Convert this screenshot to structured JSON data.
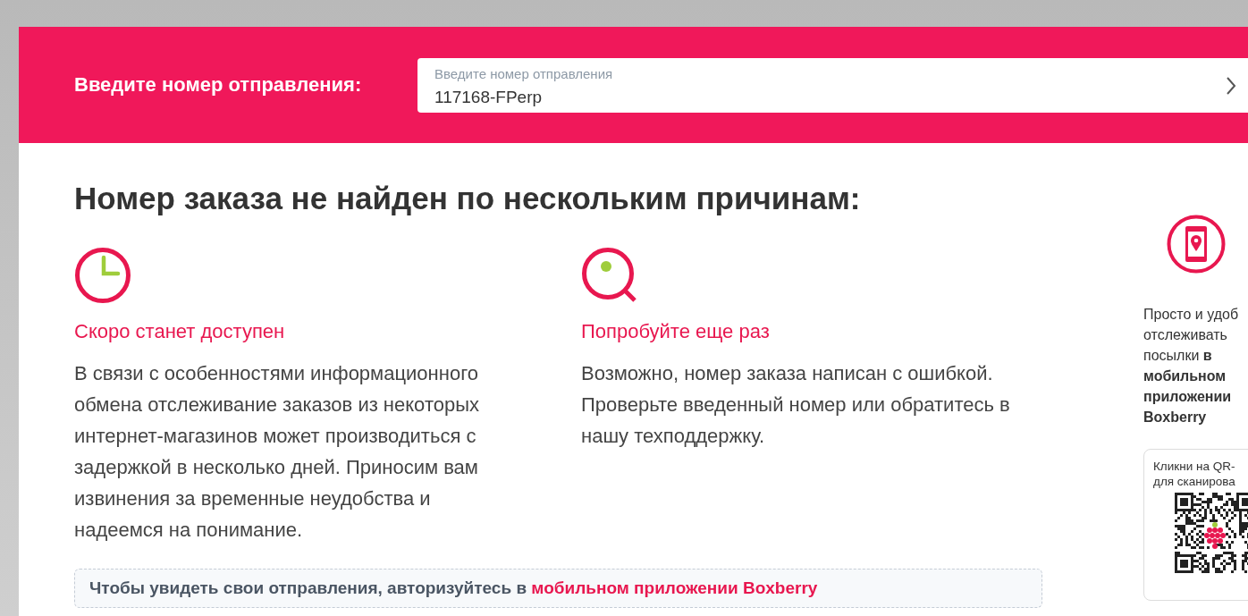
{
  "search": {
    "prompt": "Введите номер отправления:",
    "label": "Введите номер отправления",
    "value": "117168-FPerp"
  },
  "heading": "Номер заказа не найден по нескольким причинам:",
  "reasons": [
    {
      "kind": "clock",
      "title": "Скоро станет доступен",
      "text": "В связи с особенностями информационного обмена отслеживание заказов из некоторых интернет-магазинов может производиться с задержкой в несколько дней. Приносим вам извинения за временные неудобства и надеемся на понимание."
    },
    {
      "kind": "search",
      "title": "Попробуйте еще раз",
      "text": "Возможно, номер заказа написан с ошибкой. Проверьте введенный номер или обратитесь в нашу техподдержку."
    }
  ],
  "notice": {
    "text": "Чтобы увидеть свои отправления, авторизуйтесь в",
    "link": "мобильном приложении Boxberry"
  },
  "app_promo": {
    "text": "Просто и удоб\nотслеживать\nпосылки **в**\n**мобильном**\n**приложении**\n**Boxberry**",
    "qr_caption": "Кликни на QR-\nдля сканирова"
  }
}
